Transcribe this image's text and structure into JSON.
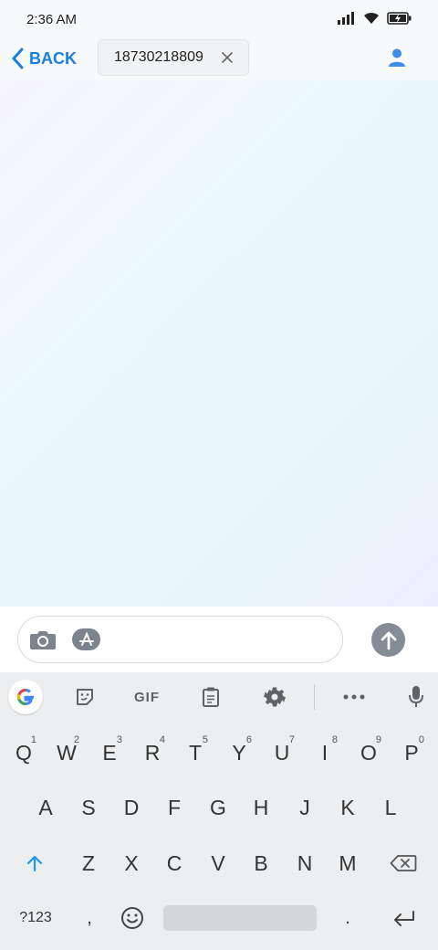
{
  "status_bar": {
    "time": "2:36 AM"
  },
  "nav": {
    "back_label": "BACK",
    "recipient": "18730218809"
  },
  "keyboard": {
    "toolbar": {
      "gif_label": "GIF"
    },
    "row1": [
      "Q",
      "W",
      "E",
      "R",
      "T",
      "Y",
      "U",
      "I",
      "O",
      "P"
    ],
    "row1_hints": [
      "1",
      "2",
      "3",
      "4",
      "5",
      "6",
      "7",
      "8",
      "9",
      "0"
    ],
    "row2": [
      "A",
      "S",
      "D",
      "F",
      "G",
      "H",
      "J",
      "K",
      "L"
    ],
    "row3": [
      "Z",
      "X",
      "C",
      "V",
      "B",
      "N",
      "M"
    ],
    "symbols_label": "?123",
    "comma": ",",
    "period": "."
  },
  "colors": {
    "accent": "#1a7fe3",
    "send_button": "#868c96",
    "keyboard_bg": "#eceef0"
  }
}
